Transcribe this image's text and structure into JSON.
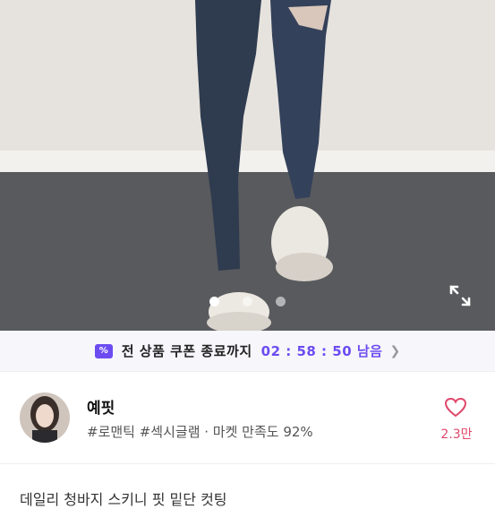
{
  "coupon": {
    "icon": "coupon-percent-icon",
    "label": "전 상품 쿠폰 종료까지",
    "timer": "02 : 58 : 50 남음",
    "accent": "#6c4cf1"
  },
  "carousel": {
    "slide_count": 3,
    "active_index": 0
  },
  "shop": {
    "name": "예핏",
    "tags": "#로맨틱 #섹시글램 · 마켓 만족도 92%",
    "likes": "2.3만",
    "like_color": "#e0476b"
  },
  "description": "데일리 청바지 스키니 핏 밑단 컷팅"
}
